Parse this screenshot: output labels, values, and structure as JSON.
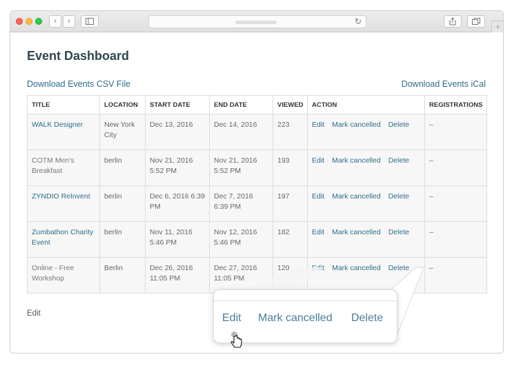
{
  "browser": {
    "address_text": ""
  },
  "page": {
    "title": "Event Dashboard",
    "download_csv": "Download Events CSV File",
    "download_ical": "Download Events iCal",
    "bottom_edit": "Edit"
  },
  "table": {
    "headers": [
      "TITLE",
      "LOCATION",
      "START DATE",
      "END DATE",
      "VIEWED",
      "ACTION",
      "REGISTRATIONS"
    ],
    "actions": {
      "edit": "Edit",
      "mark_cancelled": "Mark cancelled",
      "delete": "Delete"
    },
    "rows": [
      {
        "title": "WALK Designer",
        "title_is_link": true,
        "location": "New York City",
        "start": "Dec 13, 2016",
        "end": "Dec 14, 2016",
        "viewed": "223",
        "registrations": "–"
      },
      {
        "title": "COTM Men's Breakfast",
        "title_is_link": false,
        "location": "berlin",
        "start": "Nov 21, 2016 5:52 PM",
        "end": "Nov 21, 2016 5:52 PM",
        "viewed": "193",
        "registrations": "–"
      },
      {
        "title": "ZYNDIO ReInvent",
        "title_is_link": true,
        "location": "berlin",
        "start": "Dec 6, 2016 6:39 PM",
        "end": "Dec 7, 2016 6:39 PM",
        "viewed": "197",
        "registrations": "–"
      },
      {
        "title": "Zumbathon Charity Event",
        "title_is_link": true,
        "location": "berlin",
        "start": "Nov 11, 2016 5:46 PM",
        "end": "Nov 12, 2016 5:46 PM",
        "viewed": "182",
        "registrations": "–"
      },
      {
        "title": "Online - Free Workshop",
        "title_is_link": false,
        "location": "Berlin",
        "start": "Dec 26, 2016 11:05 PM",
        "end": "Dec 27, 2016 11:05 PM",
        "viewed": "120",
        "registrations": "–"
      }
    ]
  },
  "zoom": {
    "edit": "Edit",
    "mark_cancelled": "Mark cancelled",
    "delete": "Delete"
  },
  "colors": {
    "link": "#2d6c8a",
    "title": "#2e4651",
    "zoom_link": "#4a7c9a"
  }
}
